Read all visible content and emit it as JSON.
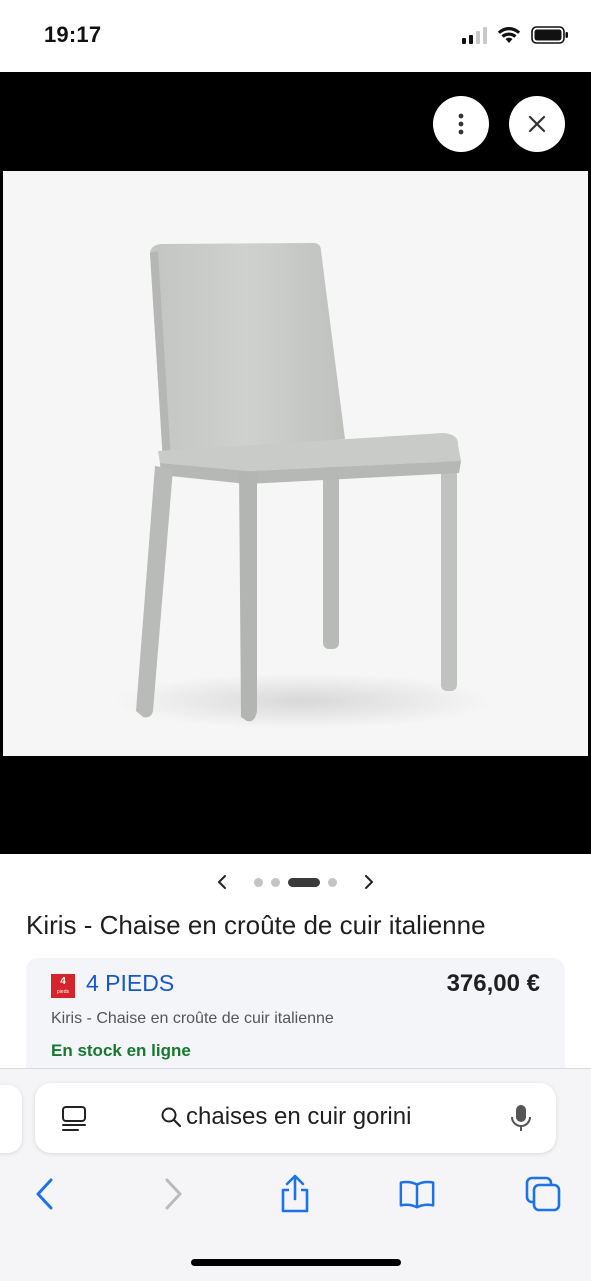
{
  "status_bar": {
    "time": "19:17"
  },
  "viewer": {
    "more_icon": "more-vertical-icon",
    "close_icon": "close-icon",
    "image_alt": "Kiris - Chaise en croûte de cuir italienne"
  },
  "carousel": {
    "prev_icon": "chevron-left-icon",
    "next_icon": "chevron-right-icon",
    "page_count": 4,
    "active_index": 2
  },
  "product": {
    "title": "Kiris - Chaise en croûte de cuir italienne"
  },
  "offer": {
    "store_logo_number": "4",
    "store_logo_text": "pieds",
    "store_name": "4 PIEDS",
    "price": "376,00 €",
    "description": "Kiris - Chaise en croûte de cuir italienne",
    "stock": "En stock en ligne"
  },
  "browser": {
    "search_text": "chaises en cuir gorini",
    "reader_icon": "page-menu-icon",
    "mic_icon": "microphone-icon",
    "nav": [
      "back-icon",
      "forward-icon",
      "share-icon",
      "bookmarks-icon",
      "tabs-icon"
    ]
  },
  "colors": {
    "accent": "#1a73e8",
    "store_link": "#1a56c8",
    "stock_green": "#18782f",
    "logo_red": "#d6242b"
  }
}
